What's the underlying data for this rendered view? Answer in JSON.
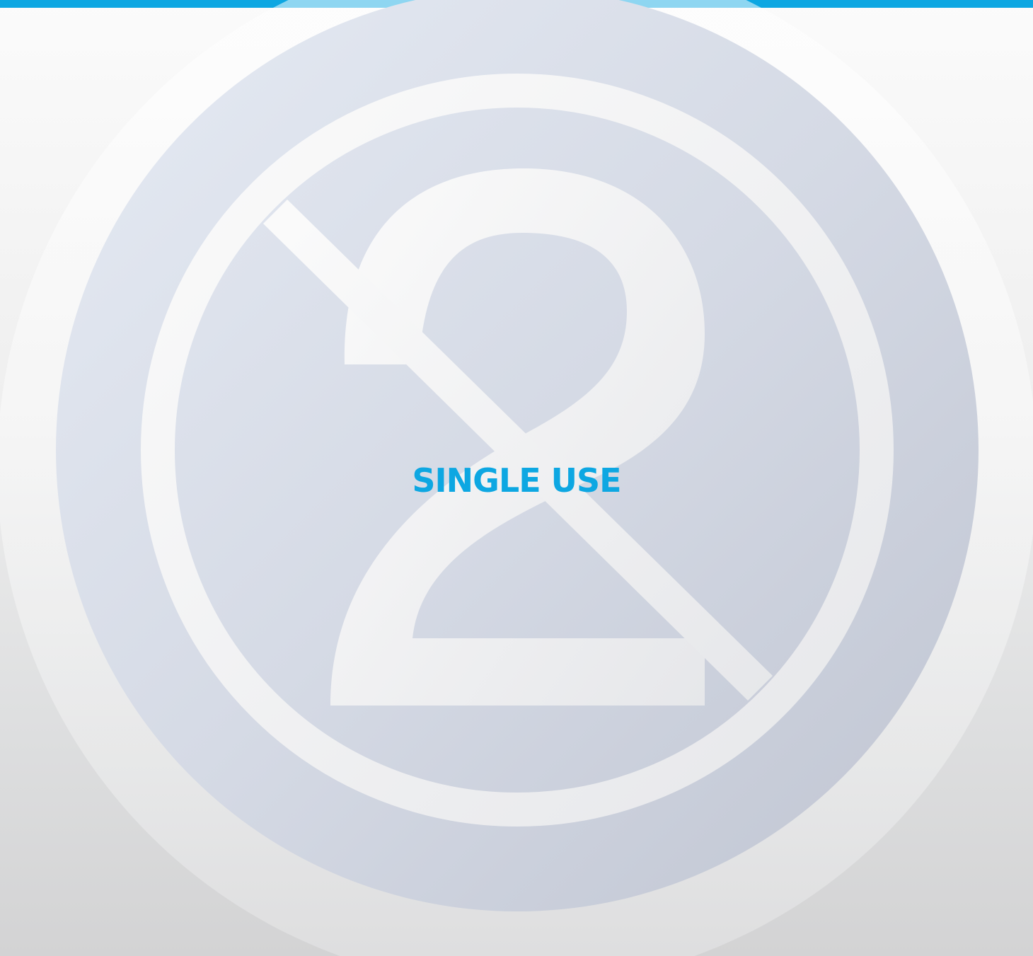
{
  "label": "SINGLE USE",
  "symbol": {
    "icon": "do-not-reuse-icon",
    "numeral": "2",
    "colors": {
      "accent": "#0da7e2",
      "disc_light": "#e4e9f3",
      "disc_dark": "#c2c7d4",
      "ring": "#f4f4f4"
    }
  }
}
